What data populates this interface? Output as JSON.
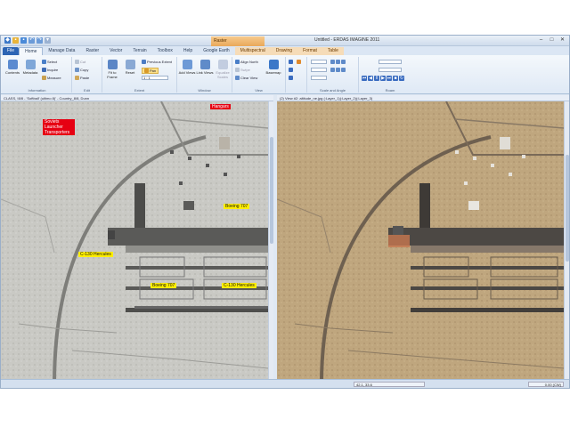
{
  "app": {
    "title": "Untitled - ERDAS IMAGINE 2011",
    "context_tab": "Raster"
  },
  "tabs": [
    "File",
    "Home",
    "Manage Data",
    "Raster",
    "Vector",
    "Terrain",
    "Toolbox",
    "Help",
    "Google Earth",
    "Multispectral",
    "Drawing",
    "Format",
    "Table"
  ],
  "ribbon": {
    "groups": {
      "information": "Information",
      "edit": "Edit",
      "extent": "Extent",
      "window": "Window",
      "view": "View",
      "scale_angle": "Scale and Angle",
      "roam": "Roam"
    },
    "info": {
      "contents": "Contents",
      "metadata": "Metadata",
      "select": "Select",
      "inquire": "Inquire",
      "measure": "Measure"
    },
    "edit": {
      "cut": "Cut",
      "copy": "Copy",
      "paste": "Paste"
    },
    "extent": {
      "fit_to_frame": "Fit to Frame",
      "reset": "Reset",
      "previous_extent": "Previous Extent",
      "pan": "Pan",
      "scale_value": "1 : 1"
    },
    "window": {
      "add_views": "Add Views",
      "link_views": "Link Views",
      "equalize_scales": "Equalize Scales"
    },
    "view": {
      "align_north": "Align North",
      "swipe": "Swipe",
      "clear_view": "Clear View",
      "basemap": "Basemap"
    }
  },
  "views": {
    "left_title": "CLASS, !8/8 - 'Softball' (ultimo 8)' - Country_8/8, Dunn",
    "right_title": "(2) View #2: altitude_ne.jpg (:Layer_1)(:Layer_2)(:Layer_3)"
  },
  "annotations": {
    "top_left": "Soviets Launcher Transporters",
    "top_right": "Hangars",
    "boeing_1": "Boeing 707",
    "c130_1": "C-130 Hercules",
    "boeing_2": "Boeing 707",
    "c130_2": "C-130 Hercules"
  },
  "status": {
    "coordinates": "42.1, 33.6",
    "rotation": "0.00 (CW)"
  },
  "colors": {
    "annotation_yellow": "#ffee00",
    "annotation_red": "#e60012",
    "ribbon_blue": "#2c64b4"
  }
}
